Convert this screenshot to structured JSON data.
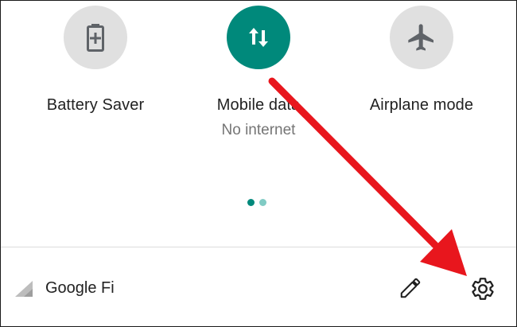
{
  "colors": {
    "accent": "#00897b",
    "tile_off": "#e0e0e0",
    "icon_off": "#5f6368",
    "annotation_arrow": "#e8161d"
  },
  "tiles": [
    {
      "label": "Battery Saver",
      "sublabel": "",
      "icon": "battery-saver-icon",
      "active": false
    },
    {
      "label": "Mobile data",
      "sublabel": "No internet",
      "icon": "mobile-data-icon",
      "active": true
    },
    {
      "label": "Airplane mode",
      "sublabel": "",
      "icon": "airplane-icon",
      "active": false
    }
  ],
  "pager": {
    "pages": 2,
    "current": 1
  },
  "footer": {
    "network_name": "Google Fi",
    "signal_icon": "signal-icon",
    "edit_icon": "pencil-icon",
    "settings_icon": "gear-icon"
  }
}
